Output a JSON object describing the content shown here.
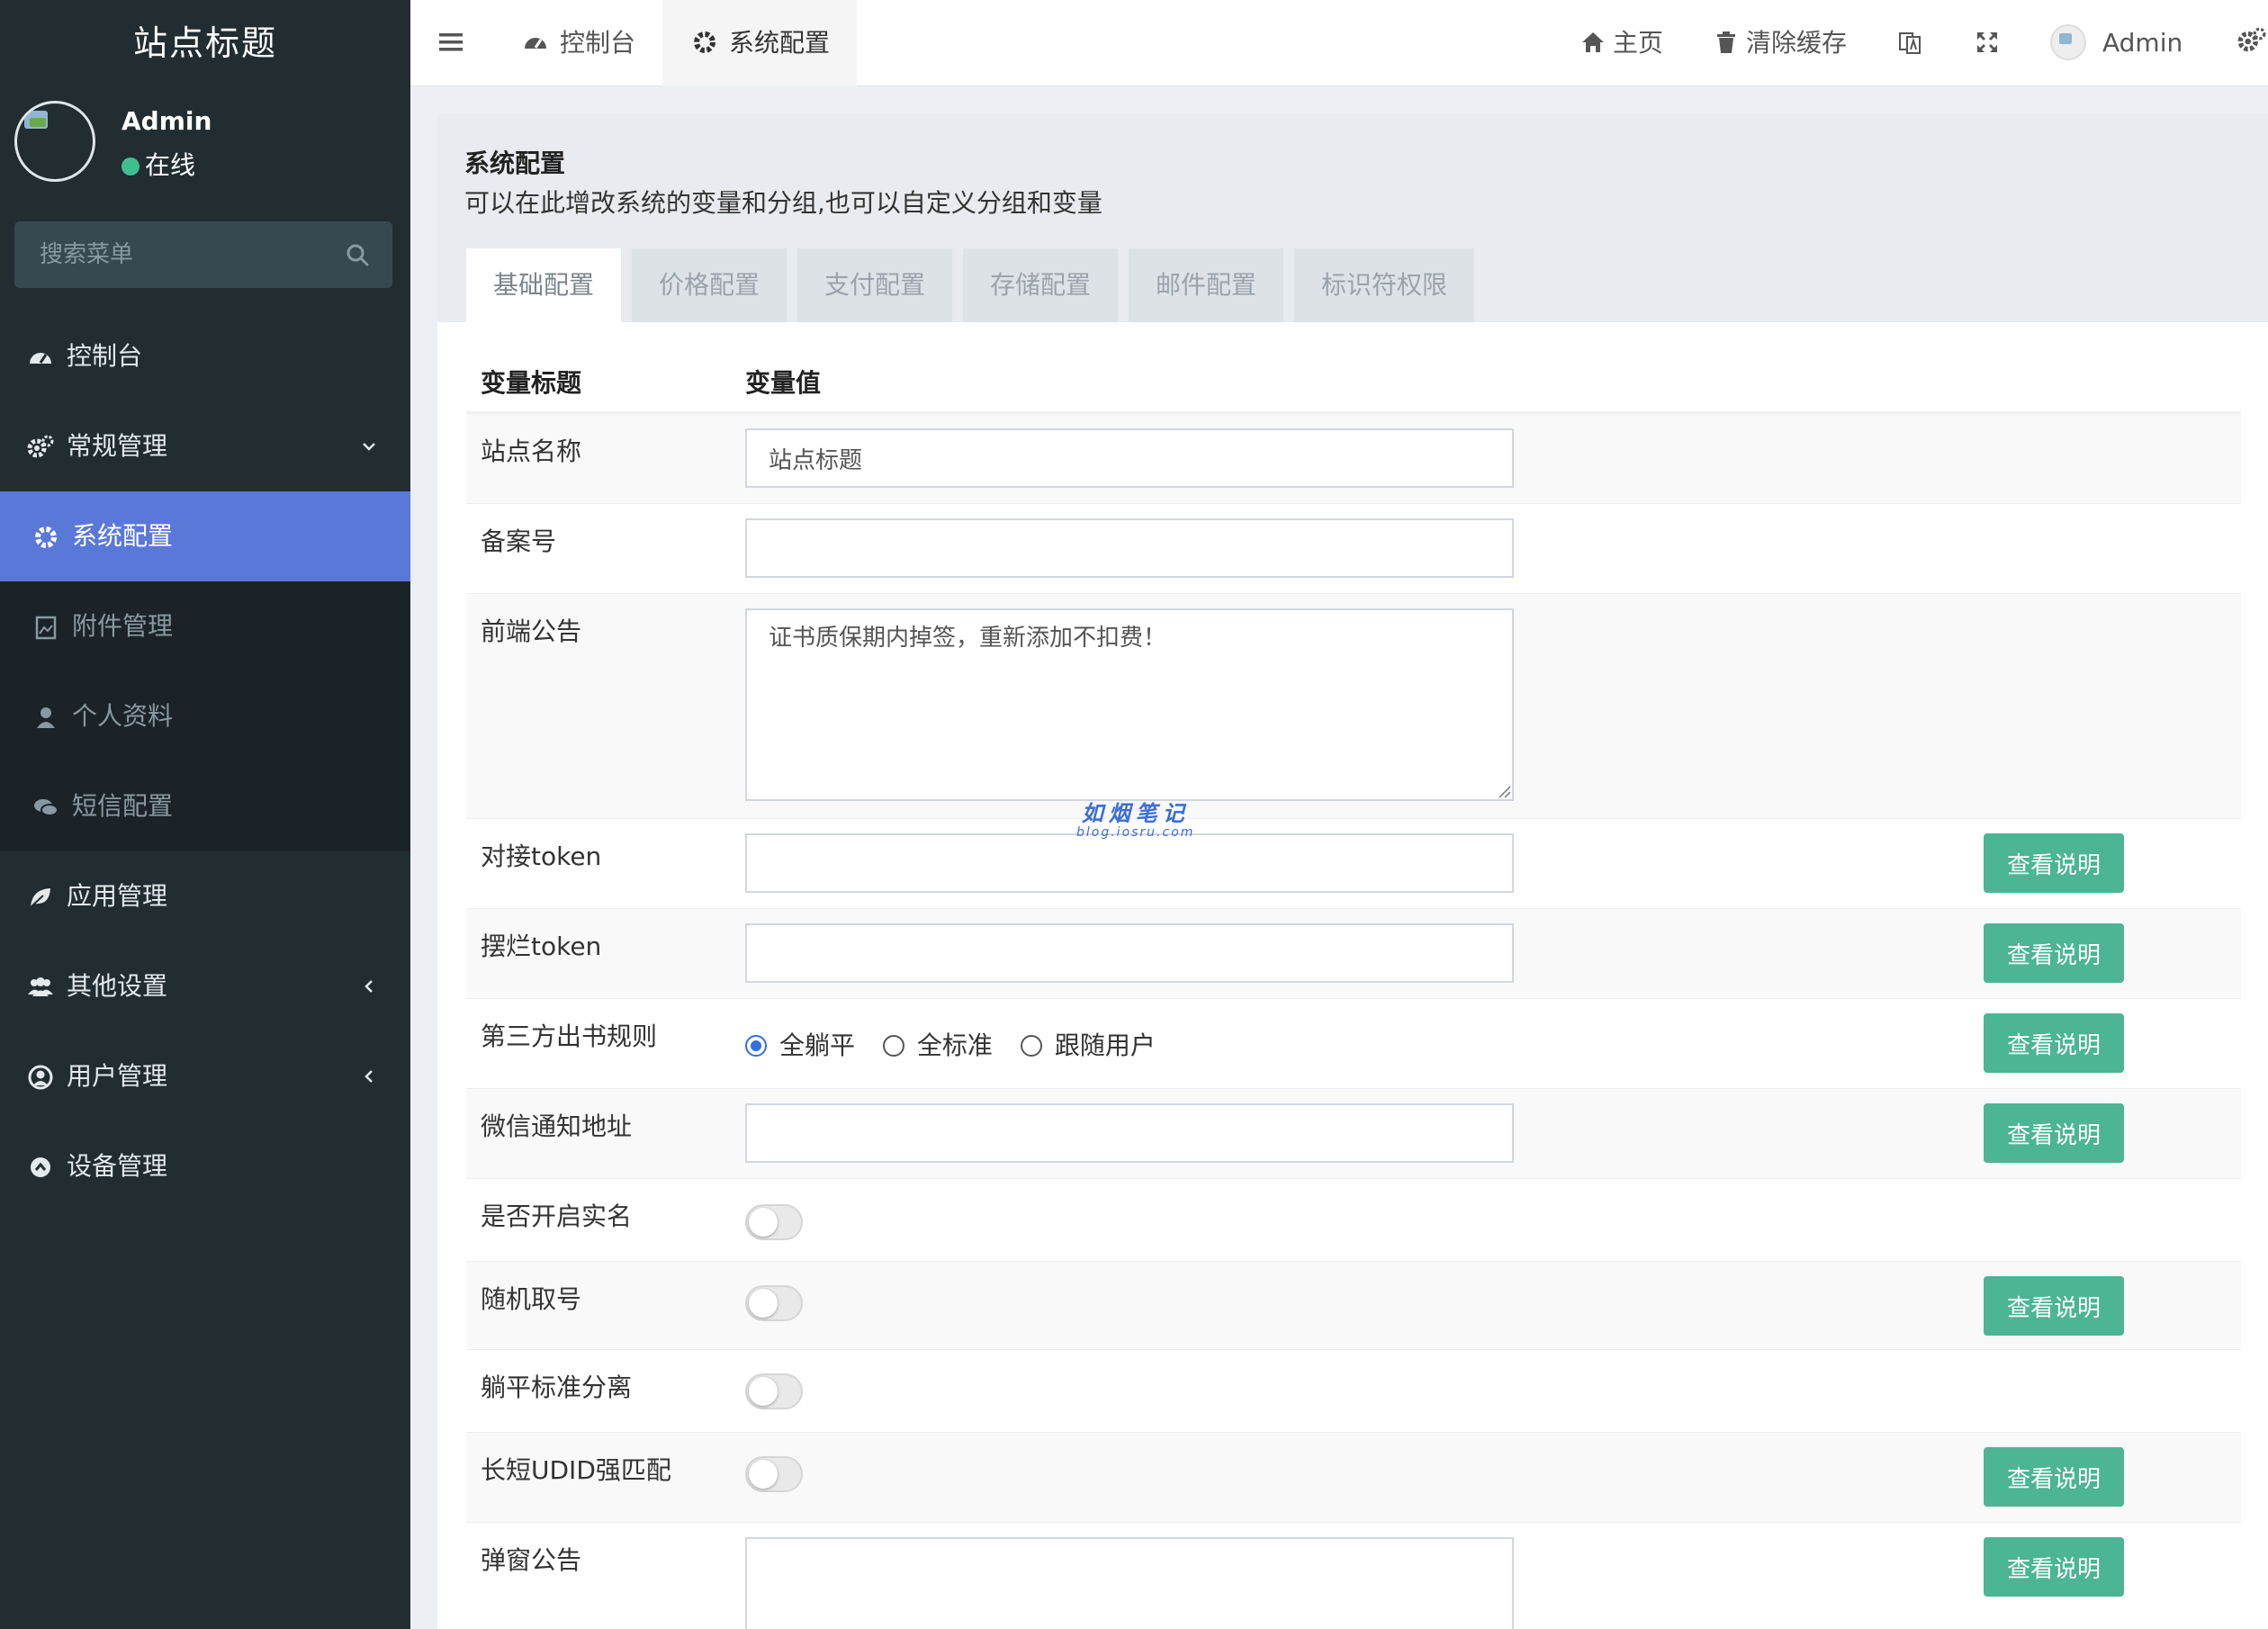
{
  "sidebar": {
    "logo": "站点标题",
    "user": {
      "name": "Admin",
      "status": "在线"
    },
    "search": {
      "placeholder": "搜索菜单"
    },
    "menu": {
      "dashboard": "控制台",
      "general": "常规管理",
      "sub": {
        "config": "系统配置",
        "attachment": "附件管理",
        "profile": "个人资料",
        "sms": "短信配置"
      },
      "apps": "应用管理",
      "other": "其他设置",
      "users": "用户管理",
      "devices": "设备管理"
    }
  },
  "header": {
    "tabs": [
      "控制台",
      "系统配置"
    ],
    "home": "主页",
    "clear_cache": "清除缓存",
    "admin": "Admin"
  },
  "panel": {
    "title": "系统配置",
    "description": "可以在此增改系统的变量和分组,也可以自定义分组和变量",
    "tabs": [
      "基础配置",
      "价格配置",
      "支付配置",
      "存储配置",
      "邮件配置",
      "标识符权限"
    ],
    "active_tab": "基础配置",
    "columns": [
      "变量标题",
      "变量值"
    ]
  },
  "rows": {
    "site_name": {
      "label": "站点名称",
      "value": "站点标题"
    },
    "icp": {
      "label": "备案号",
      "value": ""
    },
    "notice": {
      "label": "前端公告",
      "value": "证书质保期内掉签，重新添加不扣费！"
    },
    "dock_token": {
      "label": "对接token",
      "value": ""
    },
    "bailan_token": {
      "label": "摆烂token",
      "value": ""
    },
    "third_rule": {
      "label": "第三方出书规则",
      "options": [
        "全躺平",
        "全标准",
        "跟随用户"
      ],
      "selected": "全躺平"
    },
    "wechat_url": {
      "label": "微信通知地址",
      "value": ""
    },
    "realname": {
      "label": "是否开启实名",
      "on": false
    },
    "random_num": {
      "label": "随机取号",
      "on": false
    },
    "separate": {
      "label": "躺平标准分离",
      "on": false
    },
    "udid_match": {
      "label": "长短UDID强匹配",
      "on": false
    },
    "popup": {
      "label": "弹窗公告",
      "value": ""
    }
  },
  "help_button_label": "查看说明",
  "watermark": {
    "main": "如烟笔记",
    "sub": "blog.iosru.com"
  },
  "colors": {
    "sidebar_bg": "#222d32",
    "active_menu": "#5a78d8",
    "help_button": "#4bb594",
    "radio_selected": "#2f6fe0",
    "online_dot": "#3fbf8f"
  }
}
